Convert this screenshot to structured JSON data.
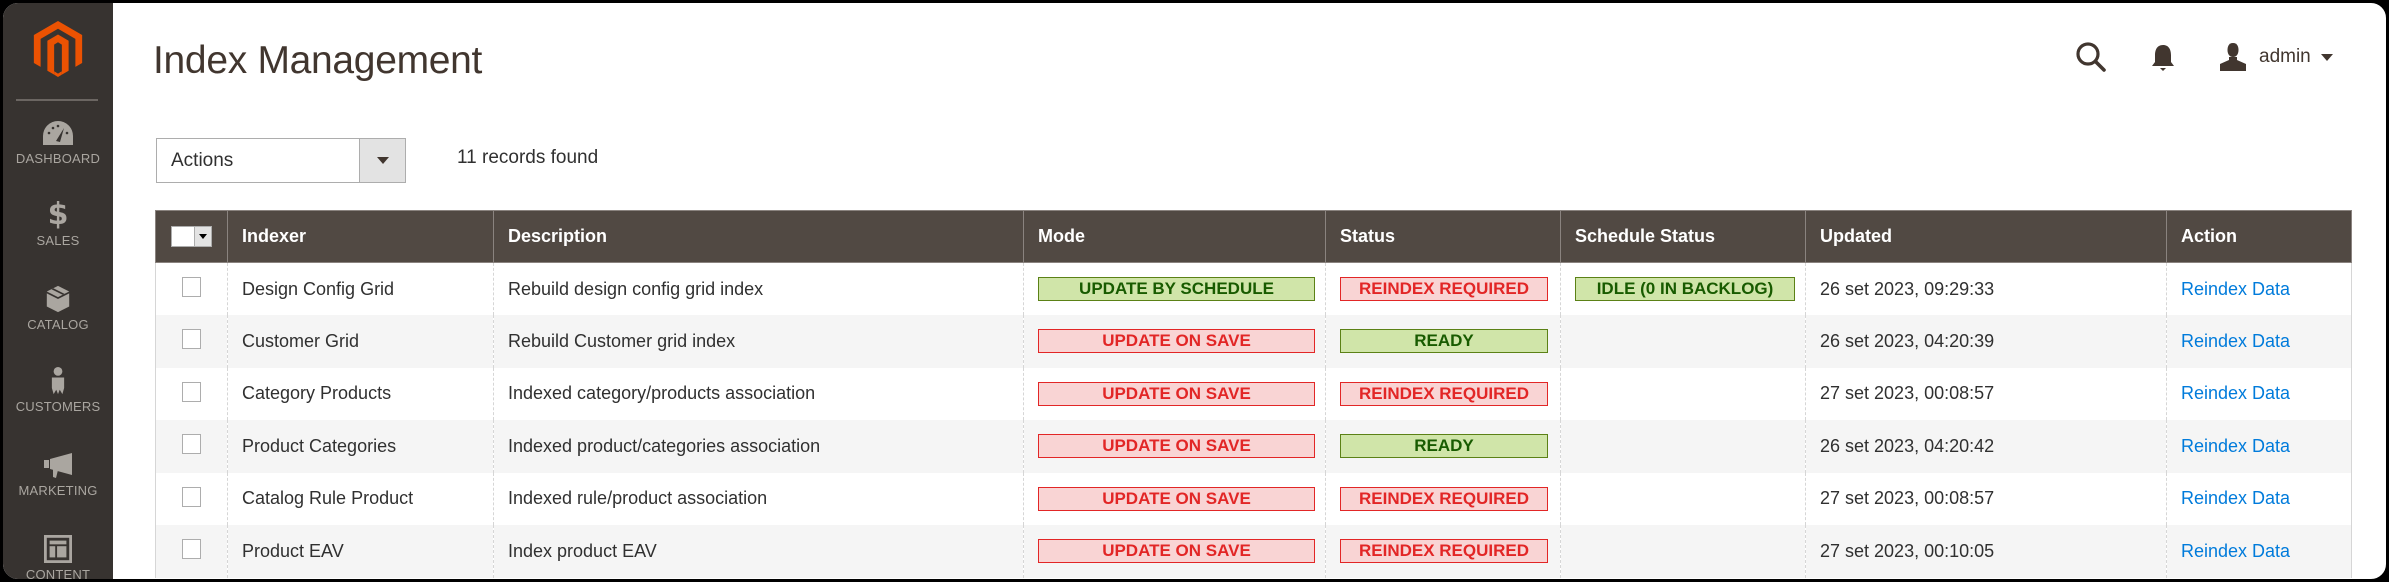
{
  "sidebar": {
    "logo": "magento-logo",
    "items": [
      {
        "label": "DASHBOARD",
        "icon": "dashboard-icon"
      },
      {
        "label": "SALES",
        "icon": "dollar-icon"
      },
      {
        "label": "CATALOG",
        "icon": "box-icon"
      },
      {
        "label": "CUSTOMERS",
        "icon": "person-icon"
      },
      {
        "label": "MARKETING",
        "icon": "megaphone-icon"
      },
      {
        "label": "CONTENT",
        "icon": "layout-icon"
      }
    ]
  },
  "header": {
    "title": "Index Management",
    "search_icon": "search-icon",
    "notifications_icon": "bell-icon",
    "user_icon": "user-icon",
    "user_name": "admin"
  },
  "toolbar": {
    "actions_label": "Actions",
    "records_found": "11 records found"
  },
  "table": {
    "columns": [
      "Indexer",
      "Description",
      "Mode",
      "Status",
      "Schedule Status",
      "Updated",
      "Action"
    ],
    "rows": [
      {
        "indexer": "Design Config Grid",
        "description": "Rebuild design config grid index",
        "mode": "UPDATE BY SCHEDULE",
        "mode_type": "green",
        "status": "REINDEX REQUIRED",
        "status_type": "red",
        "schedule_status": "IDLE (0 IN BACKLOG)",
        "schedule_type": "green",
        "updated": "26 set 2023, 09:29:33",
        "action": "Reindex Data"
      },
      {
        "indexer": "Customer Grid",
        "description": "Rebuild Customer grid index",
        "mode": "UPDATE ON SAVE",
        "mode_type": "red",
        "status": "READY",
        "status_type": "green",
        "schedule_status": "",
        "schedule_type": "",
        "updated": "26 set 2023, 04:20:39",
        "action": "Reindex Data"
      },
      {
        "indexer": "Category Products",
        "description": "Indexed category/products association",
        "mode": "UPDATE ON SAVE",
        "mode_type": "red",
        "status": "REINDEX REQUIRED",
        "status_type": "red",
        "schedule_status": "",
        "schedule_type": "",
        "updated": "27 set 2023, 00:08:57",
        "action": "Reindex Data"
      },
      {
        "indexer": "Product Categories",
        "description": "Indexed product/categories association",
        "mode": "UPDATE ON SAVE",
        "mode_type": "red",
        "status": "READY",
        "status_type": "green",
        "schedule_status": "",
        "schedule_type": "",
        "updated": "26 set 2023, 04:20:42",
        "action": "Reindex Data"
      },
      {
        "indexer": "Catalog Rule Product",
        "description": "Indexed rule/product association",
        "mode": "UPDATE ON SAVE",
        "mode_type": "red",
        "status": "REINDEX REQUIRED",
        "status_type": "red",
        "schedule_status": "",
        "schedule_type": "",
        "updated": "27 set 2023, 00:08:57",
        "action": "Reindex Data"
      },
      {
        "indexer": "Product EAV",
        "description": "Index product EAV",
        "mode": "UPDATE ON SAVE",
        "mode_type": "red",
        "status": "REINDEX REQUIRED",
        "status_type": "red",
        "schedule_status": "",
        "schedule_type": "",
        "updated": "27 set 2023, 00:10:05",
        "action": "Reindex Data"
      }
    ]
  },
  "colors": {
    "sidebar_bg": "#373330",
    "brand_orange": "#eb5202",
    "header_bg": "#514943",
    "badge_green_bg": "#d0e5a9",
    "badge_green_text": "#185b00",
    "badge_red_bg": "#f9d4d4",
    "badge_red_text": "#e22626",
    "link": "#007bdb"
  }
}
